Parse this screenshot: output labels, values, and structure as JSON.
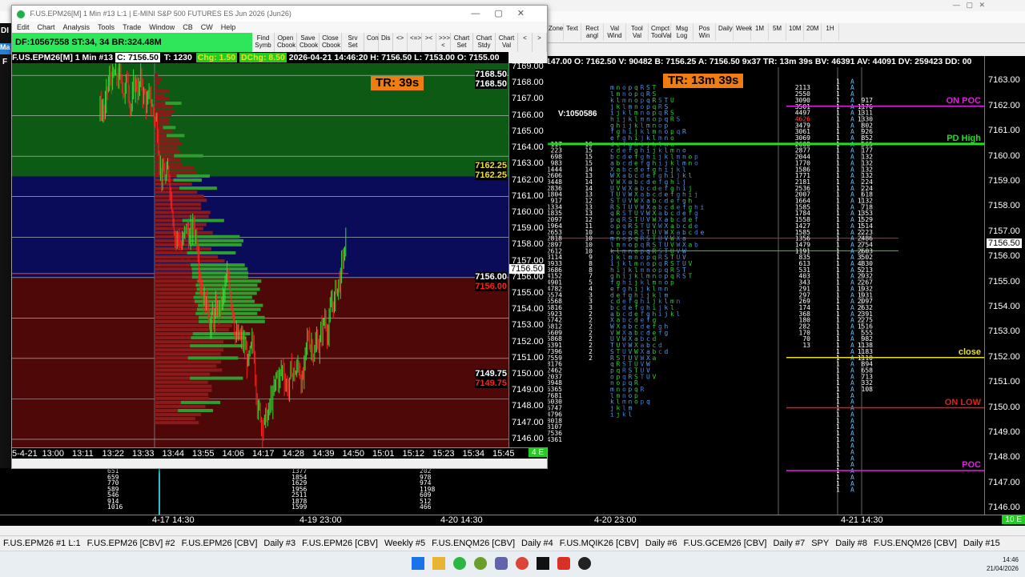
{
  "back_window": {
    "toolbar": [
      "Zone",
      "Text",
      "Rect angl",
      "Val Wind",
      "Tool Val",
      "Cmpct ToolVal",
      "Msg Log",
      "Pos Win",
      "Daily",
      "Week",
      "1M",
      "5M",
      "10M",
      "20M",
      "1H"
    ],
    "info_line": "147.00 O: 7162.50 V: 90482 B: 7156.25 A: 7156.50 9x37 TR: 13m 39s BV: 46391 AV: 44091 DV: 259423 DD: 00",
    "tr_label": "TR: 13m 39s",
    "volume_label": "V:1050586",
    "side_letters": [
      "DI",
      "F",
      "Ma"
    ],
    "levels": [
      {
        "label": "ON POC",
        "price": 7162.0,
        "color": "#e020e0"
      },
      {
        "label": "PD High",
        "price": 7160.5,
        "color": "#22dd22"
      },
      {
        "label": "close",
        "price": 7152.0,
        "color": "#e8e020"
      },
      {
        "label": "ON LOW",
        "price": 7150.0,
        "color": "#e02020"
      },
      {
        "label": "POC",
        "price": 7147.5,
        "color": "#e020e0"
      }
    ],
    "last_price": "7156.50",
    "axis": {
      "min": 7145.75,
      "max": 7164.0,
      "ticks": [
        "7163.00",
        "7162.00",
        "7161.00",
        "7160.00",
        "7159.00",
        "7158.00",
        "7157.00",
        "7156.00",
        "7155.00",
        "7154.00",
        "7153.00",
        "7152.00",
        "7151.00",
        "7150.00",
        "7149.00",
        "7148.00",
        "7147.00",
        "7146.00"
      ]
    },
    "bottom_labels": [
      "4-17  14:30",
      "4-19  23:00",
      "4-20  14:30",
      "4-20  23:00",
      "4-21  14:30"
    ],
    "bottom_badge": "10 E",
    "left_col": [
      "117",
      "223",
      "698",
      "983",
      "1444",
      "2606",
      "3448",
      "2836",
      "1804",
      "917",
      "1334",
      "1835",
      "2097",
      "1964",
      "2653",
      "2818",
      "2897",
      "2612",
      "3114",
      "3933",
      "3686",
      "4152",
      "4901",
      "4782",
      "5574",
      "5568",
      "5816",
      "5923",
      "5742",
      "5812",
      "5609",
      "5868",
      "6391",
      "7396",
      "7559",
      "8176",
      "12462",
      "12037",
      "13948",
      "16365",
      "17681",
      "16030",
      "16747",
      "14796",
      "8018",
      "8107",
      "7536",
      "4361"
    ],
    "mid_col": [
      "16",
      "15",
      "15",
      "15",
      "14",
      "13",
      "14",
      "14",
      "13",
      "12",
      "13",
      "13",
      "12",
      "11",
      "10",
      "10",
      "10",
      "10",
      "9",
      "8",
      "8",
      "7",
      "5",
      "4",
      "3",
      "3",
      "3",
      "2",
      "2",
      "2",
      "2",
      "2",
      "2",
      "2",
      "2"
    ],
    "right_col": [
      "2113",
      "2550",
      "3090",
      "3501",
      "4497",
      "4626",
      "3479",
      "3061",
      "3069",
      "2608",
      "2877",
      "2044",
      "1770",
      "1586",
      "1771",
      "2181",
      "2536",
      "2007",
      "1664",
      "1585",
      "1784",
      "1558",
      "1427",
      "1585",
      "1356",
      "1479",
      "1191",
      "835",
      "613",
      "531",
      "403",
      "343",
      "291",
      "297",
      "269",
      "174",
      "368",
      "180",
      "282",
      "170",
      "70",
      "13"
    ],
    "far_right_col": [
      "917",
      "1176",
      "1311",
      "1330",
      "802",
      "926",
      "852",
      "565",
      "177",
      "132",
      "132",
      "132",
      "132",
      "224",
      "224",
      "618",
      "1132",
      "718",
      "1353",
      "1529",
      "1514",
      "2223",
      "2486",
      "2754",
      "2603",
      "3502",
      "4830",
      "5213",
      "2932",
      "2267",
      "1932",
      "1931",
      "2097",
      "2632",
      "2391",
      "2275",
      "1516",
      "555",
      "982",
      "1138",
      "1183",
      "1110",
      "894",
      "658",
      "713",
      "332",
      "108"
    ]
  },
  "front_window": {
    "title": "F.US.EPM26[M]  1 Min  #13 L:1 | E-MINI S&P 500 FUTURES ES Jun 2026 (Jun26)",
    "menu": [
      "Edit",
      "Chart",
      "Analysis",
      "Tools",
      "Trade",
      "Window",
      "CB",
      "CW",
      "Help"
    ],
    "df_line": "DF:10567558  ST:34, 34  BR:324.48M",
    "toolbar": [
      "Find Symb",
      "Open Cbook",
      "Save Cbook",
      "Close Cbook",
      "Srv Set",
      "Con",
      "Dis",
      "<>",
      "<=>",
      "><",
      ">>><",
      "Chart Set",
      "Chart Stdy",
      "Chart Val",
      "<",
      ">"
    ],
    "info": {
      "symbol": "F.US.EPM26[M]  1 Min  #13",
      "close": "C: 7156.50",
      "ticks": "T: 1230",
      "change": "Chg: 1.50",
      "dchange": "DChg: 8.50",
      "rest": "2026-04-21  14:46:20  H: 7156.50  L: 7153.00  O: 7155.00"
    },
    "tr_label": "TR: 39s",
    "axis": {
      "min": 7145.5,
      "max": 7169.25,
      "ticks": [
        "7169.00",
        "7168.00",
        "7167.00",
        "7166.00",
        "7165.00",
        "7164.00",
        "7163.00",
        "7162.00",
        "7161.00",
        "7160.00",
        "7159.00",
        "7158.00",
        "7157.00",
        "7156.00",
        "7155.00",
        "7154.00",
        "7153.00",
        "7152.00",
        "7151.00",
        "7150.00",
        "7149.00",
        "7148.00",
        "7147.00",
        "7146.00"
      ]
    },
    "price_labels": [
      {
        "text": "7168.50",
        "price": 7168.5,
        "color": "#ffffff",
        "bg": "#000000"
      },
      {
        "text": "7168.50",
        "price": 7167.9,
        "color": "#ffffff",
        "bg": "#000000"
      },
      {
        "text": "7162.25",
        "price": 7162.85,
        "color": "#f0e020",
        "bg": "#000000"
      },
      {
        "text": "7162.25",
        "price": 7162.25,
        "color": "#f0e020",
        "bg": "#000000"
      },
      {
        "text": "7156.00",
        "price": 7156.0,
        "color": "#ffffff",
        "bg": "#000000"
      },
      {
        "text": "7156.00",
        "price": 7155.4,
        "color": "#ff2020",
        "bg": "#000000"
      },
      {
        "text": "7149.75",
        "price": 7150.0,
        "color": "#ffffff",
        "bg": "#000000"
      },
      {
        "text": "7149.75",
        "price": 7149.4,
        "color": "#ff2020",
        "bg": "#000000"
      }
    ],
    "last_price": "7156.50",
    "time_labels": [
      "5-4-21",
      "13:00",
      "13:11",
      "13:22",
      "13:33",
      "13:44",
      "13:55",
      "14:06",
      "14:17",
      "14:28",
      "14:39",
      "14:50",
      "15:01",
      "15:12",
      "15:23",
      "15:34",
      "15:45"
    ],
    "time_badge": "4 E",
    "zones": [
      {
        "from": 7162.25,
        "to": 7169.25,
        "color": "#0d5a14"
      },
      {
        "from": 7156.0,
        "to": 7162.25,
        "color": "#0a0c5a"
      },
      {
        "from": 7145.5,
        "to": 7156.0,
        "color": "#4e0808"
      }
    ]
  },
  "lower_strip": {
    "col1": [
      "651",
      "659",
      "770",
      "589",
      "546",
      "914",
      "1016"
    ],
    "col2": [
      "1377",
      "1854",
      "1629",
      "1956",
      "2511",
      "1878",
      "1599"
    ],
    "col3": [
      "202",
      "978",
      "974",
      "1198",
      "609",
      "512",
      "466"
    ]
  },
  "tabs": [
    "F.US.EPM26 #1 L:1",
    "F.US.EPM26 [CBV] #2",
    "F.US.EPM26 [CBV]",
    "Daily #3",
    "F.US.EPM26 [CBV]",
    "Weekly #5",
    "F.US.ENQM26 [CBV]",
    "Daily #4",
    "F.US.MQIK26 [CBV]",
    "Daily #6",
    "F.US.GCEM26 [CBV]",
    "Daily #7",
    "SPY",
    "Daily #8",
    "F.US.ENQM26 [CBV]",
    "Daily #15"
  ],
  "clock": {
    "time": "14:46",
    "date": "21/04/2026"
  }
}
